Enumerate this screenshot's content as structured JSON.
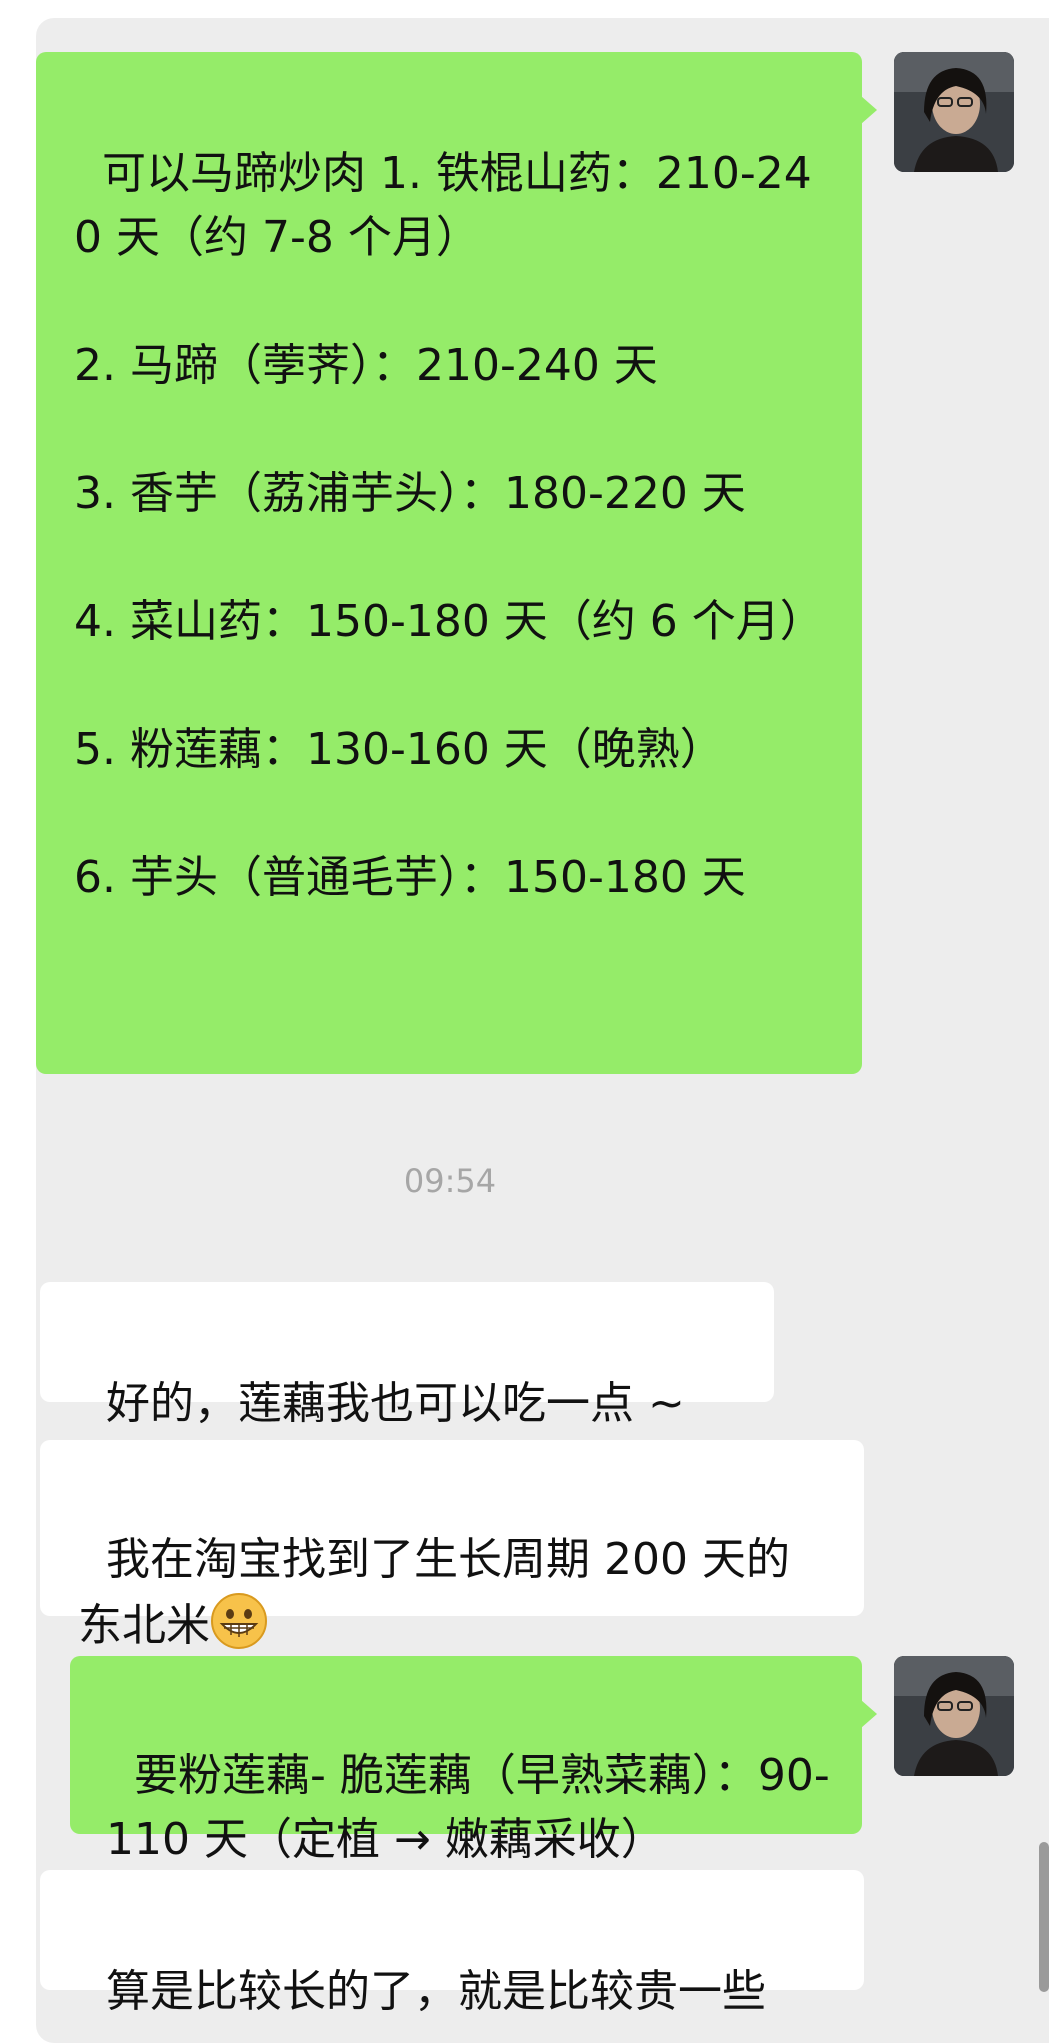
{
  "messages": {
    "m1": "可以马蹄炒肉 1. 铁棍山药：210-240 天（约 7-8 个月）\n\n2. 马蹄（荸荠）：210-240 天\n\n3. 香芋（荔浦芋头）：180-220 天\n\n4. 菜山药：150-180 天（约 6 个月）\n\n5. 粉莲藕：130-160 天（晚熟）\n\n6. 芋头（普通毛芋）：150-180 天",
    "time": "09:54",
    "m2": "好的，莲藕我也可以吃一点 ~",
    "m3": "我在淘宝找到了生长周期 200 天的东北米",
    "m4": "要粉莲藕- 脆莲藕（早熟菜藕）：90-110 天（定植 → 嫩藕采收）",
    "m5": "算是比较长的了，就是比较贵一些"
  },
  "colors": {
    "mine_bubble": "#95ec69",
    "theirs_bubble": "#ffffff",
    "chat_bg": "#ededed"
  },
  "icons": {
    "emoji": "grinning-face-emoji",
    "avatar": "user-avatar"
  }
}
